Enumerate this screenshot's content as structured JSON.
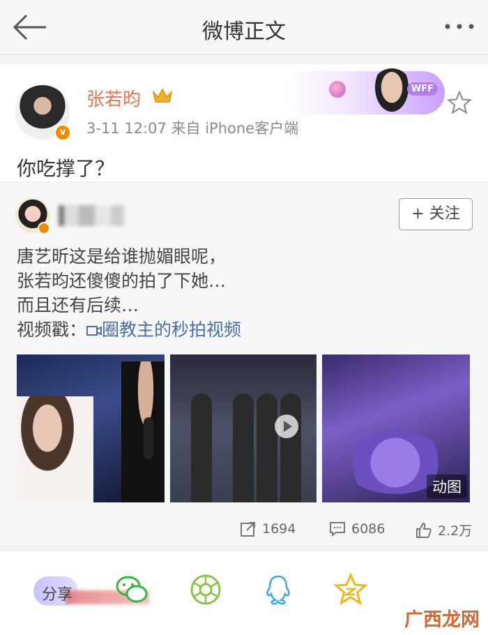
{
  "nav": {
    "title": "微博正文"
  },
  "post": {
    "author": "张若昀",
    "time": "3-11 12:07",
    "source": "来自 iPhone客户端",
    "text": "你吃撑了？",
    "banner_text": "WFF"
  },
  "repost": {
    "follow_label": "+ 关注",
    "lines": [
      "唐艺昕这是给谁抛媚眼呢，",
      "张若昀还傻傻的拍了下她…",
      "而且还有后续…"
    ],
    "video_prefix": "视频戳：",
    "video_link": "圈教主的秒拍视频",
    "gif_badge": "动图",
    "counts": {
      "repost": "1694",
      "comment": "6086",
      "like": "2.2万"
    }
  },
  "sharebar": {
    "share_label": "分享"
  },
  "watermark": "广西龙网",
  "colors": {
    "username": "#eb7350",
    "link": "#4a6ea9",
    "verified": "#f08a00"
  }
}
